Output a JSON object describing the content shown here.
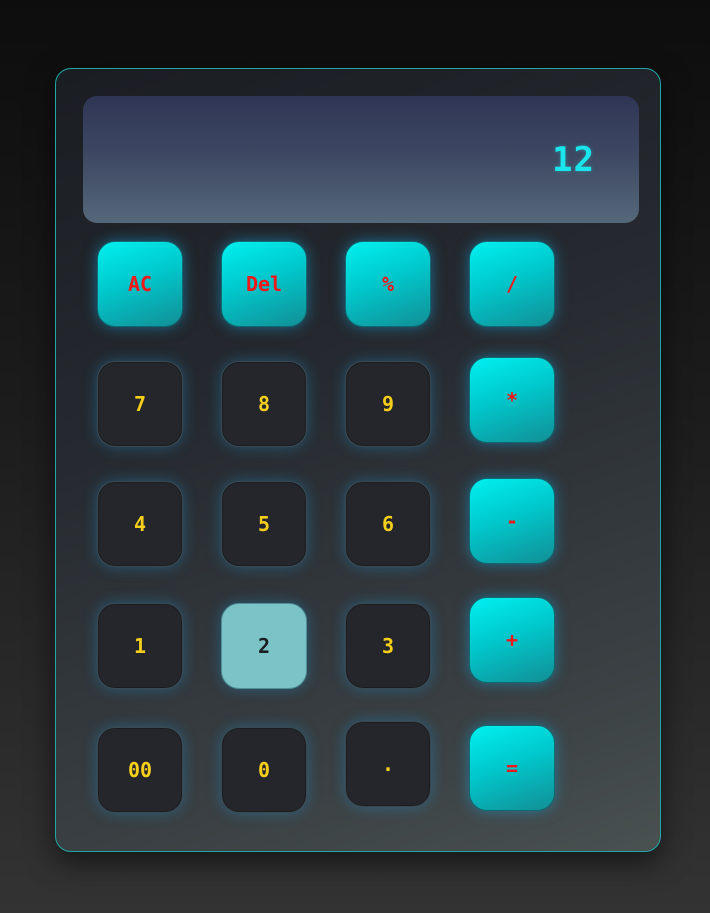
{
  "display": {
    "value": "12"
  },
  "keys": {
    "ac": "AC",
    "del": "Del",
    "percent": "%",
    "divide": "/",
    "seven": "7",
    "eight": "8",
    "nine": "9",
    "multiply": "*",
    "four": "4",
    "five": "5",
    "six": "6",
    "minus": "-",
    "one": "1",
    "two": "2",
    "three": "3",
    "plus": "+",
    "double_zero": "00",
    "zero": "0",
    "dot": ".",
    "equals": "="
  },
  "colors": {
    "display_text": "#19e6ec",
    "number_text": "#f5cf1a",
    "operator_text": "#f01818",
    "operator_key": "#00e0e4",
    "active_key": "#7cc3c8",
    "frame_border": "#1fa8a5"
  }
}
